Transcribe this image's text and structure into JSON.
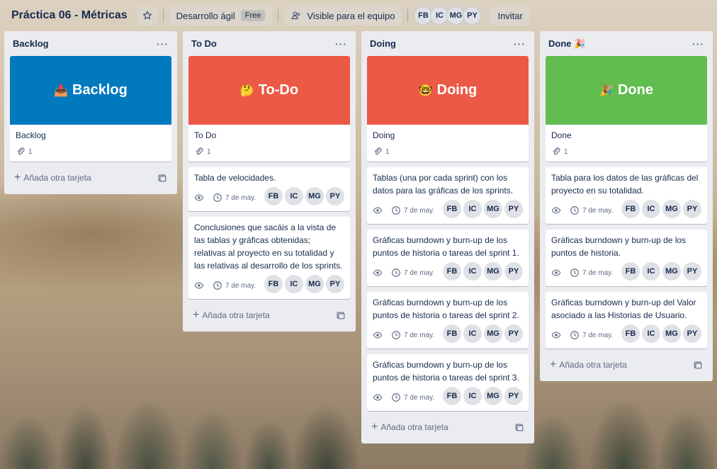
{
  "header": {
    "board_title": "Práctica 06 - Métricas",
    "star_icon": "star-icon",
    "workspace_label": "Desarrollo ágil",
    "workspace_badge": "Free",
    "visibility_label": "Visible para el equipo",
    "members": [
      "FB",
      "IC",
      "MG",
      "PY"
    ],
    "invite_label": "Invitar"
  },
  "colors": {
    "backlog": "#0079bf",
    "todo": "#eb5a46",
    "doing": "#eb5a46",
    "done": "#61bd4f"
  },
  "lists": [
    {
      "title": "Backlog",
      "cover_emoji": "📥",
      "cover_title": "Backlog",
      "cover_card_title": "Backlog",
      "attachments": "1",
      "add_label": "Añada otra tarjeta"
    },
    {
      "title": "To Do",
      "cover_emoji": "🤔",
      "cover_title": "To-Do",
      "cover_card_title": "To Do",
      "attachments": "1",
      "add_label": "Añada otra tarjeta",
      "cards": [
        {
          "title": "Tabla de velocidades.",
          "date": "7 de may.",
          "members": [
            "FB",
            "IC",
            "MG",
            "PY"
          ]
        },
        {
          "title": "Conclusiones que sacáis a la vista de las tablas y gráficas obtenidas; relativas al proyecto en su totalidad y las relativas al desarrollo de los sprints.",
          "date": "7 de may.",
          "members": [
            "FB",
            "IC",
            "MG",
            "PY"
          ]
        }
      ]
    },
    {
      "title": "Doing",
      "cover_emoji": "🤓",
      "cover_title": "Doing",
      "cover_card_title": "Doing",
      "attachments": "1",
      "add_label": "Añada otra tarjeta",
      "cards": [
        {
          "title": "Tablas (una por cada sprint) con los datos para las gráficas de los sprints.",
          "date": "7 de may.",
          "members": [
            "FB",
            "IC",
            "MG",
            "PY"
          ]
        },
        {
          "title": "Gráficas burndown y burn-up de los puntos de historia o tareas del sprint 1.",
          "date": "7 de may.",
          "members": [
            "FB",
            "IC",
            "MG",
            "PY"
          ]
        },
        {
          "title": "Gráficas burndown y burn-up de los puntos de historia o tareas del sprint 2.",
          "date": "7 de may.",
          "members": [
            "FB",
            "IC",
            "MG",
            "PY"
          ]
        },
        {
          "title": "Gráficas burndown y burn-up de los puntos de historia o tareas del sprint 3.",
          "date": "7 de may.",
          "members": [
            "FB",
            "IC",
            "MG",
            "PY"
          ]
        }
      ]
    },
    {
      "title": "Done 🎉",
      "cover_emoji": "🎉",
      "cover_title": "Done",
      "cover_card_title": "Done",
      "attachments": "1",
      "add_label": "Añada otra tarjeta",
      "cards": [
        {
          "title": "Tabla para los datos de las gráficas del proyecto en su totalidad.",
          "date": "7 de may.",
          "members": [
            "FB",
            "IC",
            "MG",
            "PY"
          ]
        },
        {
          "title": "Gráficas burndown y burn-up de los puntos de historia.",
          "date": "7 de may.",
          "members": [
            "FB",
            "IC",
            "MG",
            "PY"
          ]
        },
        {
          "title": "Gráficas burndown y burn-up del Valor asociado a las Historias de Usuario.",
          "date": "7 de may.",
          "members": [
            "FB",
            "IC",
            "MG",
            "PY"
          ]
        }
      ]
    }
  ]
}
